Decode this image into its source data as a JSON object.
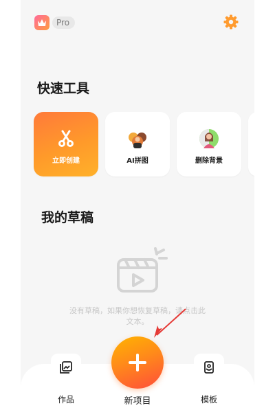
{
  "header": {
    "pro_label": "Pro"
  },
  "quick_tools": {
    "title": "快速工具",
    "items": [
      {
        "label": "立即创建",
        "icon": "scissors-icon"
      },
      {
        "label": "AI拼图",
        "icon": "ai-collage-icon"
      },
      {
        "label": "删除背景",
        "icon": "remove-background-icon"
      }
    ]
  },
  "drafts": {
    "title": "我的草稿",
    "empty_text": "没有草稿，如果你想恢复草稿，请点击此文本。"
  },
  "bottom_nav": {
    "works_label": "作品",
    "new_project_label": "新项目",
    "templates_label": "模板"
  },
  "colors": {
    "accent_orange": "#ff8a1a",
    "arrow_red": "#e53935",
    "settings_orange": "#ff9b2f"
  }
}
